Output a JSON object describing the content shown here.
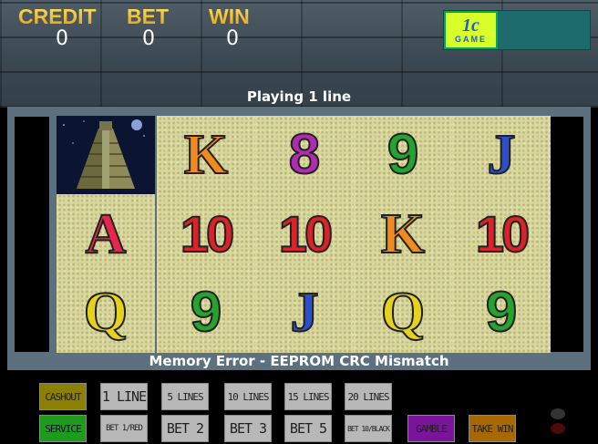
{
  "hud": {
    "credit_label": "CREDIT",
    "bet_label": "BET",
    "win_label": "WIN",
    "credit_value": "0",
    "bet_value": "0",
    "win_value": "0"
  },
  "logo": {
    "mark": "1c",
    "word": "GAME"
  },
  "playing_text": "Playing 1 line",
  "reels": [
    [
      "pyramid-icon",
      "A",
      "Q"
    ],
    [
      "K",
      "10",
      "9"
    ],
    [
      "8",
      "10",
      "J"
    ],
    [
      "9",
      "K",
      "Q"
    ],
    [
      "J",
      "10",
      "9"
    ]
  ],
  "reel_symbols": {
    "r1c2": "A",
    "r1c3": "Q",
    "r2c1": "K",
    "r2c2": "10",
    "r2c3": "9",
    "r3c1": "8",
    "r3c2": "10",
    "r3c3": "J",
    "r4c1": "9",
    "r4c2": "K",
    "r4c3": "Q",
    "r5c1": "J",
    "r5c2": "10",
    "r5c3": "9"
  },
  "status_message": "Memory Error - EEPROM CRC Mismatch",
  "buttons": {
    "cashout": "CASHOUT",
    "line1": "1 LINE",
    "lines5": "5 LINES",
    "lines10": "10 LINES",
    "lines15": "15 LINES",
    "lines20": "20 LINES",
    "service": "SERVICE",
    "bet1red": "BET 1/RED",
    "bet2": "BET 2",
    "bet3": "BET 3",
    "bet5": "BET 5",
    "bet10black": "BET 10/BLACK",
    "gamble": "GAMBLE",
    "takewin": "TAKE WIN"
  },
  "colors": {
    "hud_gold": "#f2b800",
    "reel_bg": "#d9d79a",
    "frame": "#5d7080",
    "cashout": "#8c8000",
    "service": "#1d9b1d",
    "gamble": "#7a149b",
    "takewin": "#a86800"
  }
}
